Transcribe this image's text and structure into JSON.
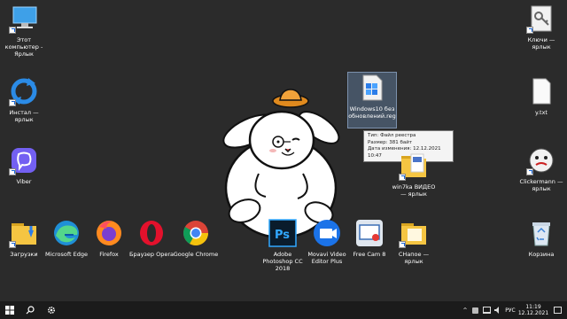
{
  "desktop_icons": {
    "this_pc": "Этот компьютер - Ярлык",
    "install": "Инстал — ярлык",
    "viber": "Viber",
    "downloads": "Загрузки",
    "edge": "Microsoft Edge",
    "firefox": "Firefox",
    "opera": "Браузер Opera",
    "chrome": "Google Chrome",
    "photoshop": "Adobe Photoshop CC 2018",
    "movavi": "Movavi Video Editor Plus",
    "freecam": "Free Cam 8",
    "new_shortcut": "СНапое — ярлык",
    "reg_file": "Windows10 без обновлений.reg",
    "win7video": "win7ka ВИДЕО — ярлык",
    "keys": "Ключи — ярлык",
    "ytxt": "y.txt",
    "clickermann": "Clickermann — ярлык",
    "recycle": "Корзина"
  },
  "tooltip": {
    "line1": "Тип: Файл реестра",
    "line2": "Размер: 381 байт",
    "line3": "Дата изменения: 12.12.2021 10:47"
  },
  "taskbar": {
    "lang": "РУС",
    "time": "11:19",
    "date": "12.12.2021"
  }
}
